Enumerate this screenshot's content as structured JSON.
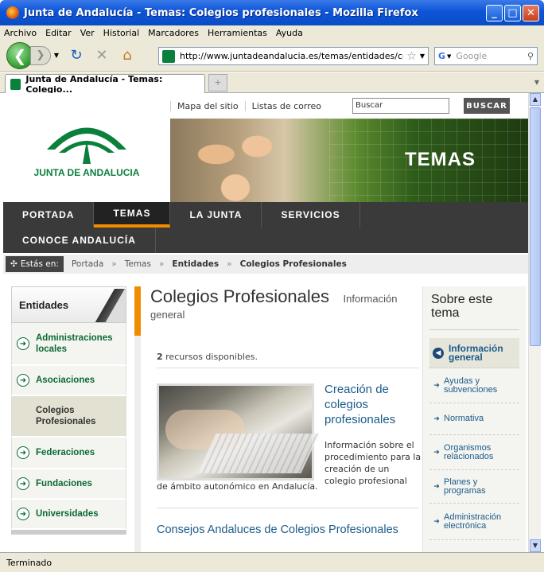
{
  "window": {
    "title": "Junta de Andalucía - Temas: Colegios profesionales - Mozilla Firefox",
    "minimize": "_",
    "maximize": "□",
    "close": "✕"
  },
  "menu": [
    "Archivo",
    "Editar",
    "Ver",
    "Historial",
    "Marcadores",
    "Herramientas",
    "Ayuda"
  ],
  "toolbar": {
    "url": "http://www.juntadeandalucia.es/temas/entidades/colegios",
    "search_placeholder": "Google"
  },
  "tab": {
    "title": "Junta de Andalucía - Temas: Colegio...",
    "new_tab": "+"
  },
  "status": "Terminado",
  "site": {
    "logo_text": "JUNTA DE ANDALUCIA",
    "top_links": [
      "Mapa del sitio",
      "Listas de correo"
    ],
    "search_value": "Buscar",
    "search_button": "BUSCAR",
    "banner_label": "TEMAS",
    "nav_row1": [
      "PORTADA",
      "TEMAS",
      "LA JUNTA",
      "SERVICIOS"
    ],
    "nav_row2": [
      "CONOCE ANDALUCÍA"
    ],
    "breadcrumb": {
      "here": "Estás en:",
      "items": [
        "Portada",
        "Temas",
        "Entidades",
        "Colegios Profesionales"
      ]
    },
    "left": {
      "heading": "Entidades",
      "items": [
        "Administraciones locales",
        "Asociaciones",
        "Colegios Profesionales",
        "Federaciones",
        "Fundaciones",
        "Universidades"
      ]
    },
    "center": {
      "title": "Colegios Profesionales",
      "subtitle_a": "Información",
      "subtitle_b": "general",
      "count_num": "2",
      "count_text": "recursos disponibles.",
      "resource_title": "Creación de colegios profesionales",
      "resource_desc": "Información sobre el procedimiento para la creación de un colegio profesional",
      "resource_desc2": "de ámbito autonómico en Andalucía.",
      "second_link": "Consejos Andaluces de Colegios Profesionales"
    },
    "right": {
      "heading": "Sobre este tema",
      "items": [
        "Información general",
        "Ayudas y subvenciones",
        "Normativa",
        "Organismos relacionados",
        "Planes y programas",
        "Administración electrónica"
      ]
    }
  },
  "colors": {
    "accent": "#f08c00",
    "green": "#0b7f3c",
    "link": "#1a5b8a"
  }
}
